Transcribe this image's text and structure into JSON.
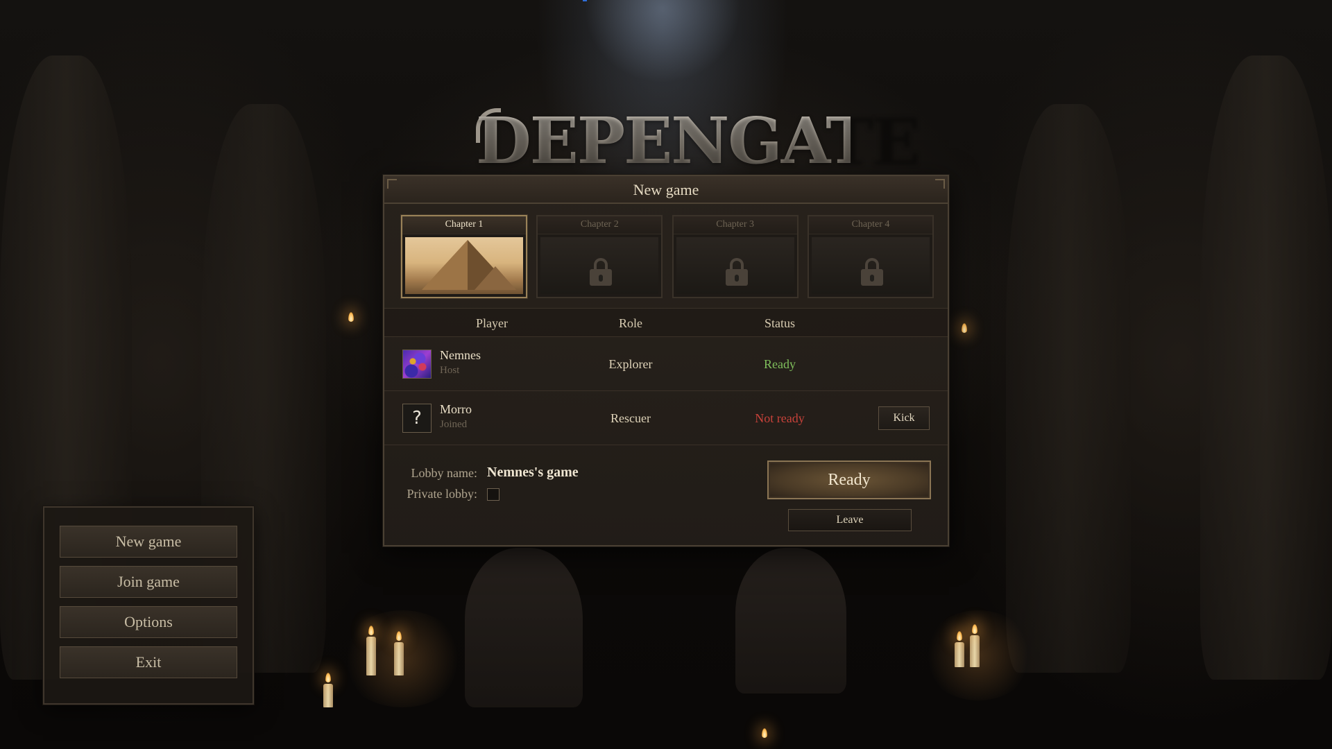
{
  "app": {
    "logo_text": "DEPENGATE"
  },
  "panel": {
    "title": "New game",
    "chapters": [
      {
        "label": "Chapter 1",
        "selected": true,
        "locked": false
      },
      {
        "label": "Chapter 2",
        "selected": false,
        "locked": true
      },
      {
        "label": "Chapter 3",
        "selected": false,
        "locked": true
      },
      {
        "label": "Chapter 4",
        "selected": false,
        "locked": true
      }
    ],
    "columns": {
      "player": "Player",
      "role": "Role",
      "status": "Status"
    },
    "players": [
      {
        "name": "Nemnes",
        "sub": "Host",
        "role": "Explorer",
        "status": "Ready",
        "avatar": "nemnes-avatar"
      },
      {
        "name": "Morro",
        "sub": "Joined",
        "role": "Rescuer",
        "status": "Not ready",
        "avatar_text": "?",
        "kick_label": "Kick"
      }
    ],
    "lobby": {
      "name_label": "Lobby name:",
      "name_value": "Nemnes's game",
      "private_label": "Private lobby:",
      "private_checked": false
    },
    "ready_label": "Ready",
    "leave_label": "Leave"
  },
  "menu": {
    "items": [
      "New game",
      "Join game",
      "Options",
      "Exit"
    ]
  },
  "colors": {
    "status_ready": "#7fbf5c",
    "status_not_ready": "#c8423a",
    "accent_gold": "#9a8258"
  }
}
